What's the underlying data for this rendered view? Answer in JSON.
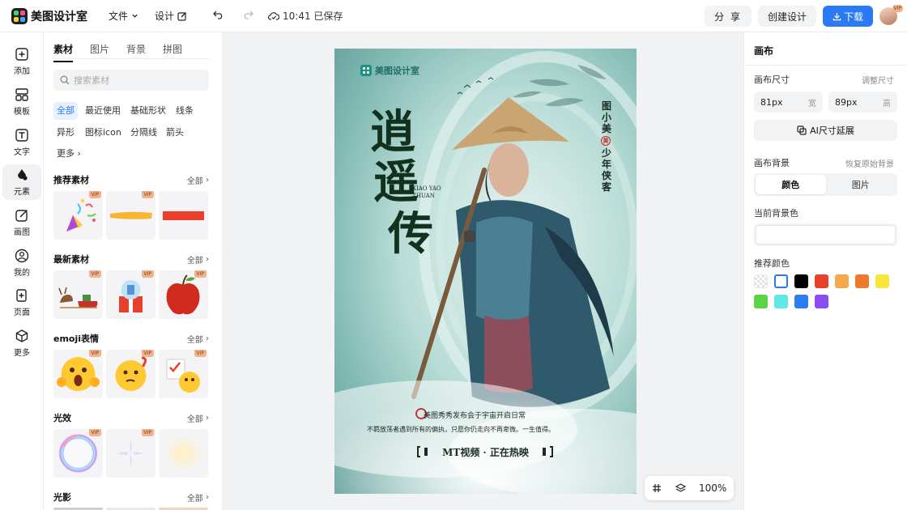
{
  "app": {
    "brand": "美图设计室",
    "menu": {
      "file": "文件",
      "design": "设计"
    },
    "save_status": "10:41 已保存",
    "share_label": "分 享",
    "create_label": "创建设计",
    "download_label": "下载",
    "avatar_badge": "VIP"
  },
  "rail": [
    {
      "label": "添加",
      "icon": "plus-square-icon"
    },
    {
      "label": "模板",
      "icon": "template-icon"
    },
    {
      "label": "文字",
      "icon": "text-icon"
    },
    {
      "label": "元素",
      "icon": "shapes-icon",
      "active": true
    },
    {
      "label": "画图",
      "icon": "draw-icon"
    },
    {
      "label": "我的",
      "icon": "user-icon"
    },
    {
      "label": "页面",
      "icon": "page-add-icon"
    },
    {
      "label": "更多",
      "icon": "cube-icon"
    }
  ],
  "assets": {
    "tabs": [
      "素材",
      "图片",
      "背景",
      "拼图"
    ],
    "search_placeholder": "搜索素材",
    "chips": [
      "全部",
      "最近使用",
      "基础形状",
      "线条",
      "异形",
      "图标icon",
      "分隔线",
      "箭头",
      "更多"
    ],
    "all_label": "全部",
    "vip_label": "VIP",
    "sections": [
      "推荐素材",
      "最新素材",
      "emoji表情",
      "光效",
      "光影"
    ]
  },
  "poster": {
    "brand": "美图设计室",
    "title_chars": [
      "逍",
      "遥",
      "传"
    ],
    "pinyin": [
      "XIAO YAO",
      "ZHUAN"
    ],
    "vertical_credit": "图小美",
    "vertical_seal": "美",
    "vertical_subtitle": "少年侠客",
    "tagline_1": "美图秀秀发布会于宇宙开启日常",
    "tagline_2": "不羁放荡者遇到所有的偏执，只愿你仍走向不再卑微。一生值得。",
    "banner": "MT视频 · 正在热映"
  },
  "zoom": {
    "level": "100%"
  },
  "inspector": {
    "title": "画布",
    "size_label": "画布尺寸",
    "size_action": "调整尺寸",
    "width_value": "81px",
    "width_unit": "宽",
    "height_value": "89px",
    "height_unit": "高",
    "ai_button": "AI尺寸延展",
    "bg_label": "画布背景",
    "bg_reset": "恢复原始背景",
    "seg_color": "颜色",
    "seg_image": "图片",
    "current_bg_label": "当前背景色",
    "current_bg_color": "#ffffff",
    "recommend_label": "推荐颜色",
    "swatches": [
      "transparent",
      "#ffffff",
      "#000000",
      "#e8402b",
      "#f4a94c",
      "#ef7a2c",
      "#f5e83a",
      "#5cd443",
      "#5ee8e6",
      "#2b7df0",
      "#8a4df0"
    ]
  },
  "colors": {
    "accent": "#2a79f5",
    "vip": "#f0b38b",
    "title_green": "#12311e"
  }
}
